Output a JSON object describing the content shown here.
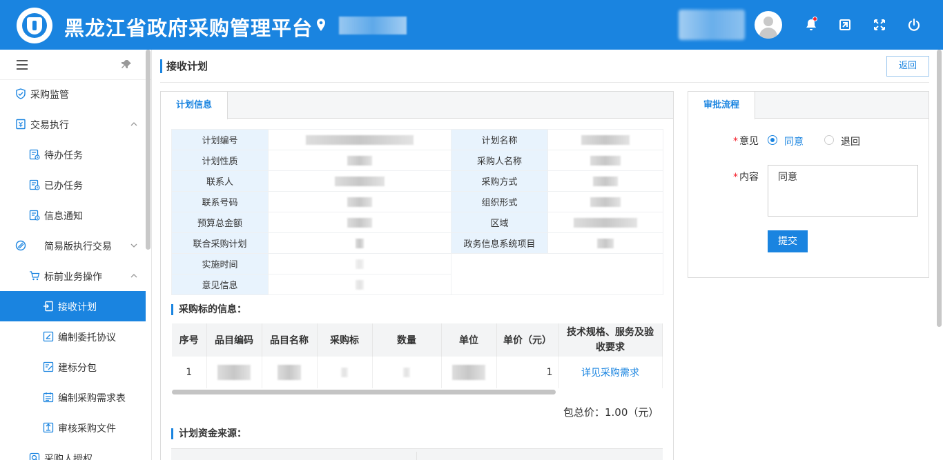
{
  "header": {
    "title": "黑龙江省政府采购管理平台",
    "icons": [
      "location-icon",
      "bell-icon",
      "screen-icon",
      "fullscreen-icon",
      "power-icon"
    ],
    "accent": "#1a84e0"
  },
  "sidebar": {
    "items": [
      {
        "label": "采购监管",
        "icon": "shield-icon"
      },
      {
        "label": "交易执行",
        "icon": "invoice-icon"
      },
      {
        "label": "待办任务",
        "icon": "task-icon"
      },
      {
        "label": "已办任务",
        "icon": "task-icon"
      },
      {
        "label": "信息通知",
        "icon": "task-icon"
      },
      {
        "label": "简易版执行交易",
        "icon": "slash-circle-icon"
      },
      {
        "label": "标前业务操作",
        "icon": "cart-icon"
      },
      {
        "label": "接收计划",
        "icon": "import-icon"
      },
      {
        "label": "编制委托协议",
        "icon": "edit-icon"
      },
      {
        "label": "建标分包",
        "icon": "edit-icon"
      },
      {
        "label": "编制采购需求表",
        "icon": "calendar-icon"
      },
      {
        "label": "审核采购文件",
        "icon": "upload-icon"
      },
      {
        "label": "采购人授权",
        "icon": "search-icon"
      }
    ]
  },
  "page": {
    "title": "接收计划",
    "back_label": "返回"
  },
  "plan_info": {
    "tab_label": "计划信息",
    "fields": {
      "plan_no": "计划编号",
      "plan_name": "计划名称",
      "plan_nature": "计划性质",
      "purchaser_name": "采购人名称",
      "contact": "联系人",
      "purchase_method": "采购方式",
      "phone": "联系号码",
      "org_form": "组织形式",
      "budget": "预算总金额",
      "region": "区域",
      "joint_plan": "联合采购计划",
      "gov_project": "政务信息系统项目",
      "impl_time": "实施时间",
      "opinion_info": "意见信息"
    }
  },
  "items_section": {
    "title": "采购标的信息：",
    "columns": [
      "序号",
      "品目编码",
      "品目名称",
      "采购标",
      "数量",
      "单位",
      "单价（元）",
      "技术规格、服务及验收要求"
    ],
    "rows": [
      {
        "index": "1",
        "price": "1",
        "link": "详见采购需求"
      }
    ],
    "total": "包总价：1.00（元）"
  },
  "fund_section": {
    "title": "计划资金来源："
  },
  "approval": {
    "tab_label": "审批流程",
    "opinion_label": "意见",
    "options": [
      "同意",
      "退回"
    ],
    "content_label": "内容",
    "content_value": "同意",
    "submit_label": "提交",
    "required_mark": "*"
  }
}
